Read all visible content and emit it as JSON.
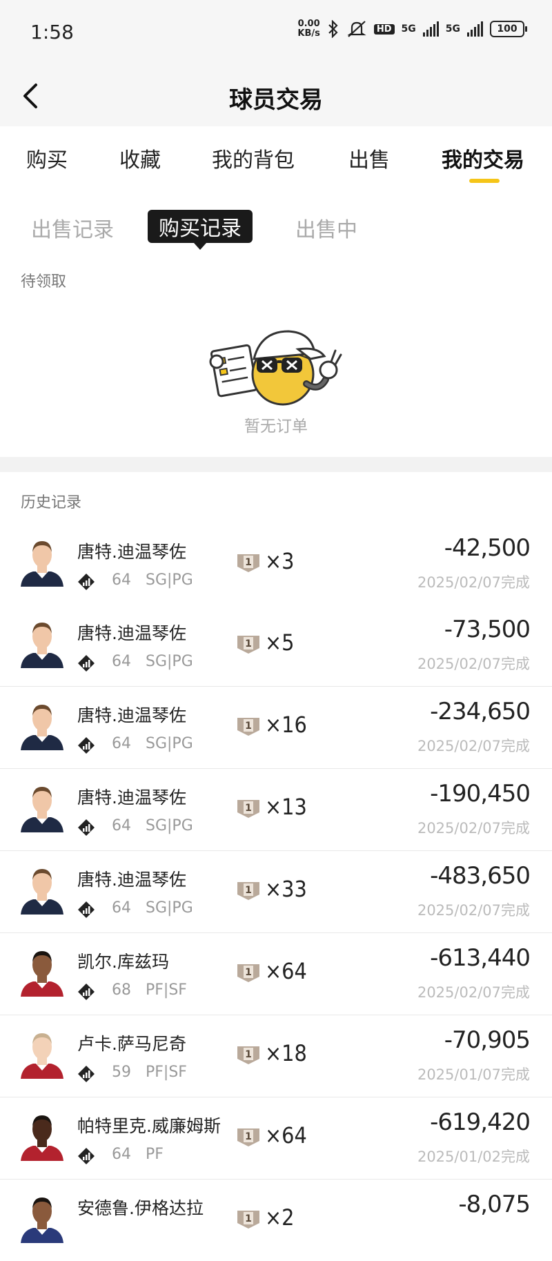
{
  "status_bar": {
    "time": "1:58",
    "net_speed_value": "0.00",
    "net_speed_unit": "KB/s",
    "hd_badge": "HD",
    "sim1": "5G",
    "sim2": "5G",
    "battery": "100"
  },
  "header": {
    "title": "球员交易"
  },
  "tabs": [
    {
      "label": "购买"
    },
    {
      "label": "收藏"
    },
    {
      "label": "我的背包"
    },
    {
      "label": "出售"
    },
    {
      "label": "我的交易"
    }
  ],
  "subtabs": [
    {
      "label": "出售记录"
    },
    {
      "label": "购买记录"
    },
    {
      "label": "出售中"
    }
  ],
  "pending": {
    "label": "待领取",
    "empty_text": "暂无订单"
  },
  "history": {
    "label": "历史记录",
    "items": [
      {
        "name": "唐特.迪温琴佐",
        "rating": "64",
        "position": "SG|PG",
        "card_level": "1",
        "qty": "×3",
        "amount": "-42,500",
        "date": "2025/02/07完成"
      },
      {
        "name": "唐特.迪温琴佐",
        "rating": "64",
        "position": "SG|PG",
        "card_level": "1",
        "qty": "×5",
        "amount": "-73,500",
        "date": "2025/02/07完成"
      },
      {
        "name": "唐特.迪温琴佐",
        "rating": "64",
        "position": "SG|PG",
        "card_level": "1",
        "qty": "×16",
        "amount": "-234,650",
        "date": "2025/02/07完成"
      },
      {
        "name": "唐特.迪温琴佐",
        "rating": "64",
        "position": "SG|PG",
        "card_level": "1",
        "qty": "×13",
        "amount": "-190,450",
        "date": "2025/02/07完成"
      },
      {
        "name": "唐特.迪温琴佐",
        "rating": "64",
        "position": "SG|PG",
        "card_level": "1",
        "qty": "×33",
        "amount": "-483,650",
        "date": "2025/02/07完成"
      },
      {
        "name": "凯尔.库兹玛",
        "rating": "68",
        "position": "PF|SF",
        "card_level": "1",
        "qty": "×64",
        "amount": "-613,440",
        "date": "2025/02/07完成"
      },
      {
        "name": "卢卡.萨马尼奇",
        "rating": "59",
        "position": "PF|SF",
        "card_level": "1",
        "qty": "×18",
        "amount": "-70,905",
        "date": "2025/01/07完成"
      },
      {
        "name": "帕特里克.威廉姆斯",
        "rating": "64",
        "position": "PF",
        "card_level": "1",
        "qty": "×64",
        "amount": "-619,420",
        "date": "2025/01/02完成"
      },
      {
        "name": "安德鲁.伊格达拉",
        "rating": "",
        "position": "",
        "card_level": "1",
        "qty": "×2",
        "amount": "-8,075",
        "date": ""
      }
    ]
  },
  "colors": {
    "accent": "#f5c518",
    "active_subtab_bg": "#1a1a1a"
  }
}
